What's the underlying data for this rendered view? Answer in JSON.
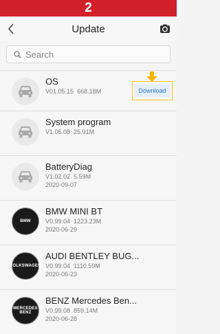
{
  "step_banner": "2",
  "header": {
    "title": "Update",
    "back_icon": "chevron-left-icon",
    "refresh_icon": "refresh-icon"
  },
  "search": {
    "placeholder": "Search"
  },
  "download_label": "Download",
  "colors": {
    "banner": "#d0202a",
    "highlight": "#f5c518",
    "link": "#2a73c7"
  },
  "items": [
    {
      "title": "OS",
      "version": "V01.05.15",
      "size": "668.18M",
      "date": "",
      "icon": "car-icon"
    },
    {
      "title": "System program",
      "version": "V1.05.08",
      "size": "25.91M",
      "date": "",
      "icon": "car-icon"
    },
    {
      "title": "BatteryDiag",
      "version": "V1.02.02",
      "size": "5.59M",
      "date": "2020-09-07",
      "icon": "car-icon"
    },
    {
      "title": "BMW MINI BT",
      "version": "V0.99.04",
      "size": "1223.23M",
      "date": "2020-06-29",
      "icon": "bmw-logo",
      "brand": "BMW"
    },
    {
      "title": "AUDI BENTLEY BUG...",
      "version": "V0.99.04",
      "size": "1110.59M",
      "date": "2020-06-23",
      "icon": "volkswagen-logo",
      "brand": "VOLKSWAGEN"
    },
    {
      "title": "BENZ Mercedes Ben...",
      "version": "V0.99.08",
      "size": "859.14M",
      "date": "2020-06-28",
      "icon": "mercedes-logo",
      "brand": "MERCEDES\nBENZ"
    }
  ]
}
